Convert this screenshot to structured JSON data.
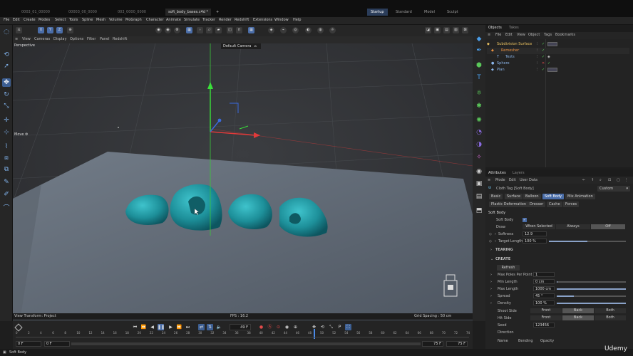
{
  "titlebar": {
    "tabs": [
      "0003_01_00000",
      "00003_00_0000",
      "003_0000_0000",
      "soft_body_bases.c4d *"
    ],
    "add_tab": "+",
    "workspaces": [
      "Startup",
      "Standard",
      "Model",
      "Sculpt"
    ],
    "active_workspace": "Startup"
  },
  "menubar": {
    "items": [
      "File",
      "Edit",
      "Create",
      "Modes",
      "Select",
      "Tools",
      "Spline",
      "Mesh",
      "Volume",
      "MoGraph",
      "Character",
      "Animate",
      "Simulate",
      "Tracker",
      "Render",
      "Redshift",
      "Extensions",
      "Window",
      "Help"
    ]
  },
  "toolbar": {
    "axis_buttons": [
      "X",
      "Y",
      "Z"
    ]
  },
  "viewport": {
    "header_menu": [
      "View",
      "Cameras",
      "Display",
      "Options",
      "Filter",
      "Panel",
      "Redshift"
    ],
    "projection": "Perspective",
    "camera": "Default Camera",
    "tool_hud": "Move",
    "bottom_left": "View Transform: Project",
    "fps": "FPS : 16.2",
    "grid_spacing": "Grid Spacing : 50 cm"
  },
  "objects": {
    "tabs": [
      "Objects",
      "Takes"
    ],
    "menu": [
      "File",
      "Edit",
      "View",
      "Object",
      "Tags",
      "Bookmarks"
    ],
    "tree": [
      {
        "name": "Subdivision Surface",
        "color": "#e8c060",
        "indent": 0
      },
      {
        "name": "Remesher",
        "color": "#e89040",
        "indent": 1
      },
      {
        "name": "Texts",
        "color": "#8ab4e8",
        "indent": 2
      },
      {
        "name": "Sphere",
        "color": "#8ab4e8",
        "indent": 0
      },
      {
        "name": "Plan",
        "color": "#8ab4e8",
        "indent": 0
      }
    ]
  },
  "attributes": {
    "tabs": [
      "Attributes",
      "Layers"
    ],
    "menu": [
      "Mode",
      "Edit",
      "User Data"
    ],
    "tag_title": "Cloth Tag [Soft Body]",
    "preset": "Custom",
    "subtabs_row1": [
      "Basic",
      "Surface",
      "Balloon",
      "Soft Body",
      "Mix Animation"
    ],
    "subtabs_row2": [
      "Plastic Deformation",
      "Dresser",
      "Cache",
      "Forces"
    ],
    "active_subtab": "Soft Body",
    "section": "Soft Body",
    "soft_body_label": "Soft Body",
    "draw_label": "Draw",
    "draw_options": [
      "When Selected",
      "Always",
      "Off"
    ],
    "draw_selected": "Off",
    "softness_label": "Softness",
    "softness_value": "12.9",
    "target_length_label": "Target Length",
    "target_length_value": "100 %",
    "target_length_fraction": 1.0,
    "tearing_label": "TEARING",
    "create_label": "CREATE",
    "refresh_label": "Refresh",
    "max_poles_label": "Max Poles Per Point",
    "max_poles_value": "1",
    "min_length_label": "Min Length",
    "min_length_value": "0 cm",
    "max_length_label": "Max Length",
    "max_length_value": "1000 cm",
    "spread_label": "Spread",
    "spread_value": "45 °",
    "density_label": "Density",
    "density_value": "100 %",
    "shoot_side_label": "Shoot Side",
    "shoot_side_options": [
      "Front",
      "Back",
      "Both"
    ],
    "hit_side_label": "Hit Side",
    "hit_side_options": [
      "Front",
      "Back",
      "Both"
    ],
    "seed_label": "Seed",
    "seed_value": "123456",
    "direction_label": "Direction",
    "name_label": "Name",
    "bending_label": "Bending",
    "opacity_label": "Opacity"
  },
  "timeline": {
    "current_frame": "49 F",
    "start_frame": "0 F",
    "start_frame2": "0 F",
    "end_frame": "75 F",
    "end_frame2": "75 F",
    "ticks": [
      "0",
      "2",
      "4",
      "6",
      "8",
      "10",
      "12",
      "14",
      "16",
      "18",
      "20",
      "22",
      "24",
      "26",
      "28",
      "30",
      "32",
      "34",
      "36",
      "38",
      "40",
      "42",
      "44",
      "46",
      "48",
      "50",
      "52",
      "54",
      "56",
      "58",
      "60",
      "62",
      "64",
      "66",
      "68",
      "70",
      "72",
      "74"
    ]
  },
  "status": {
    "text": "Soft Body",
    "watermark": "Udemy"
  }
}
